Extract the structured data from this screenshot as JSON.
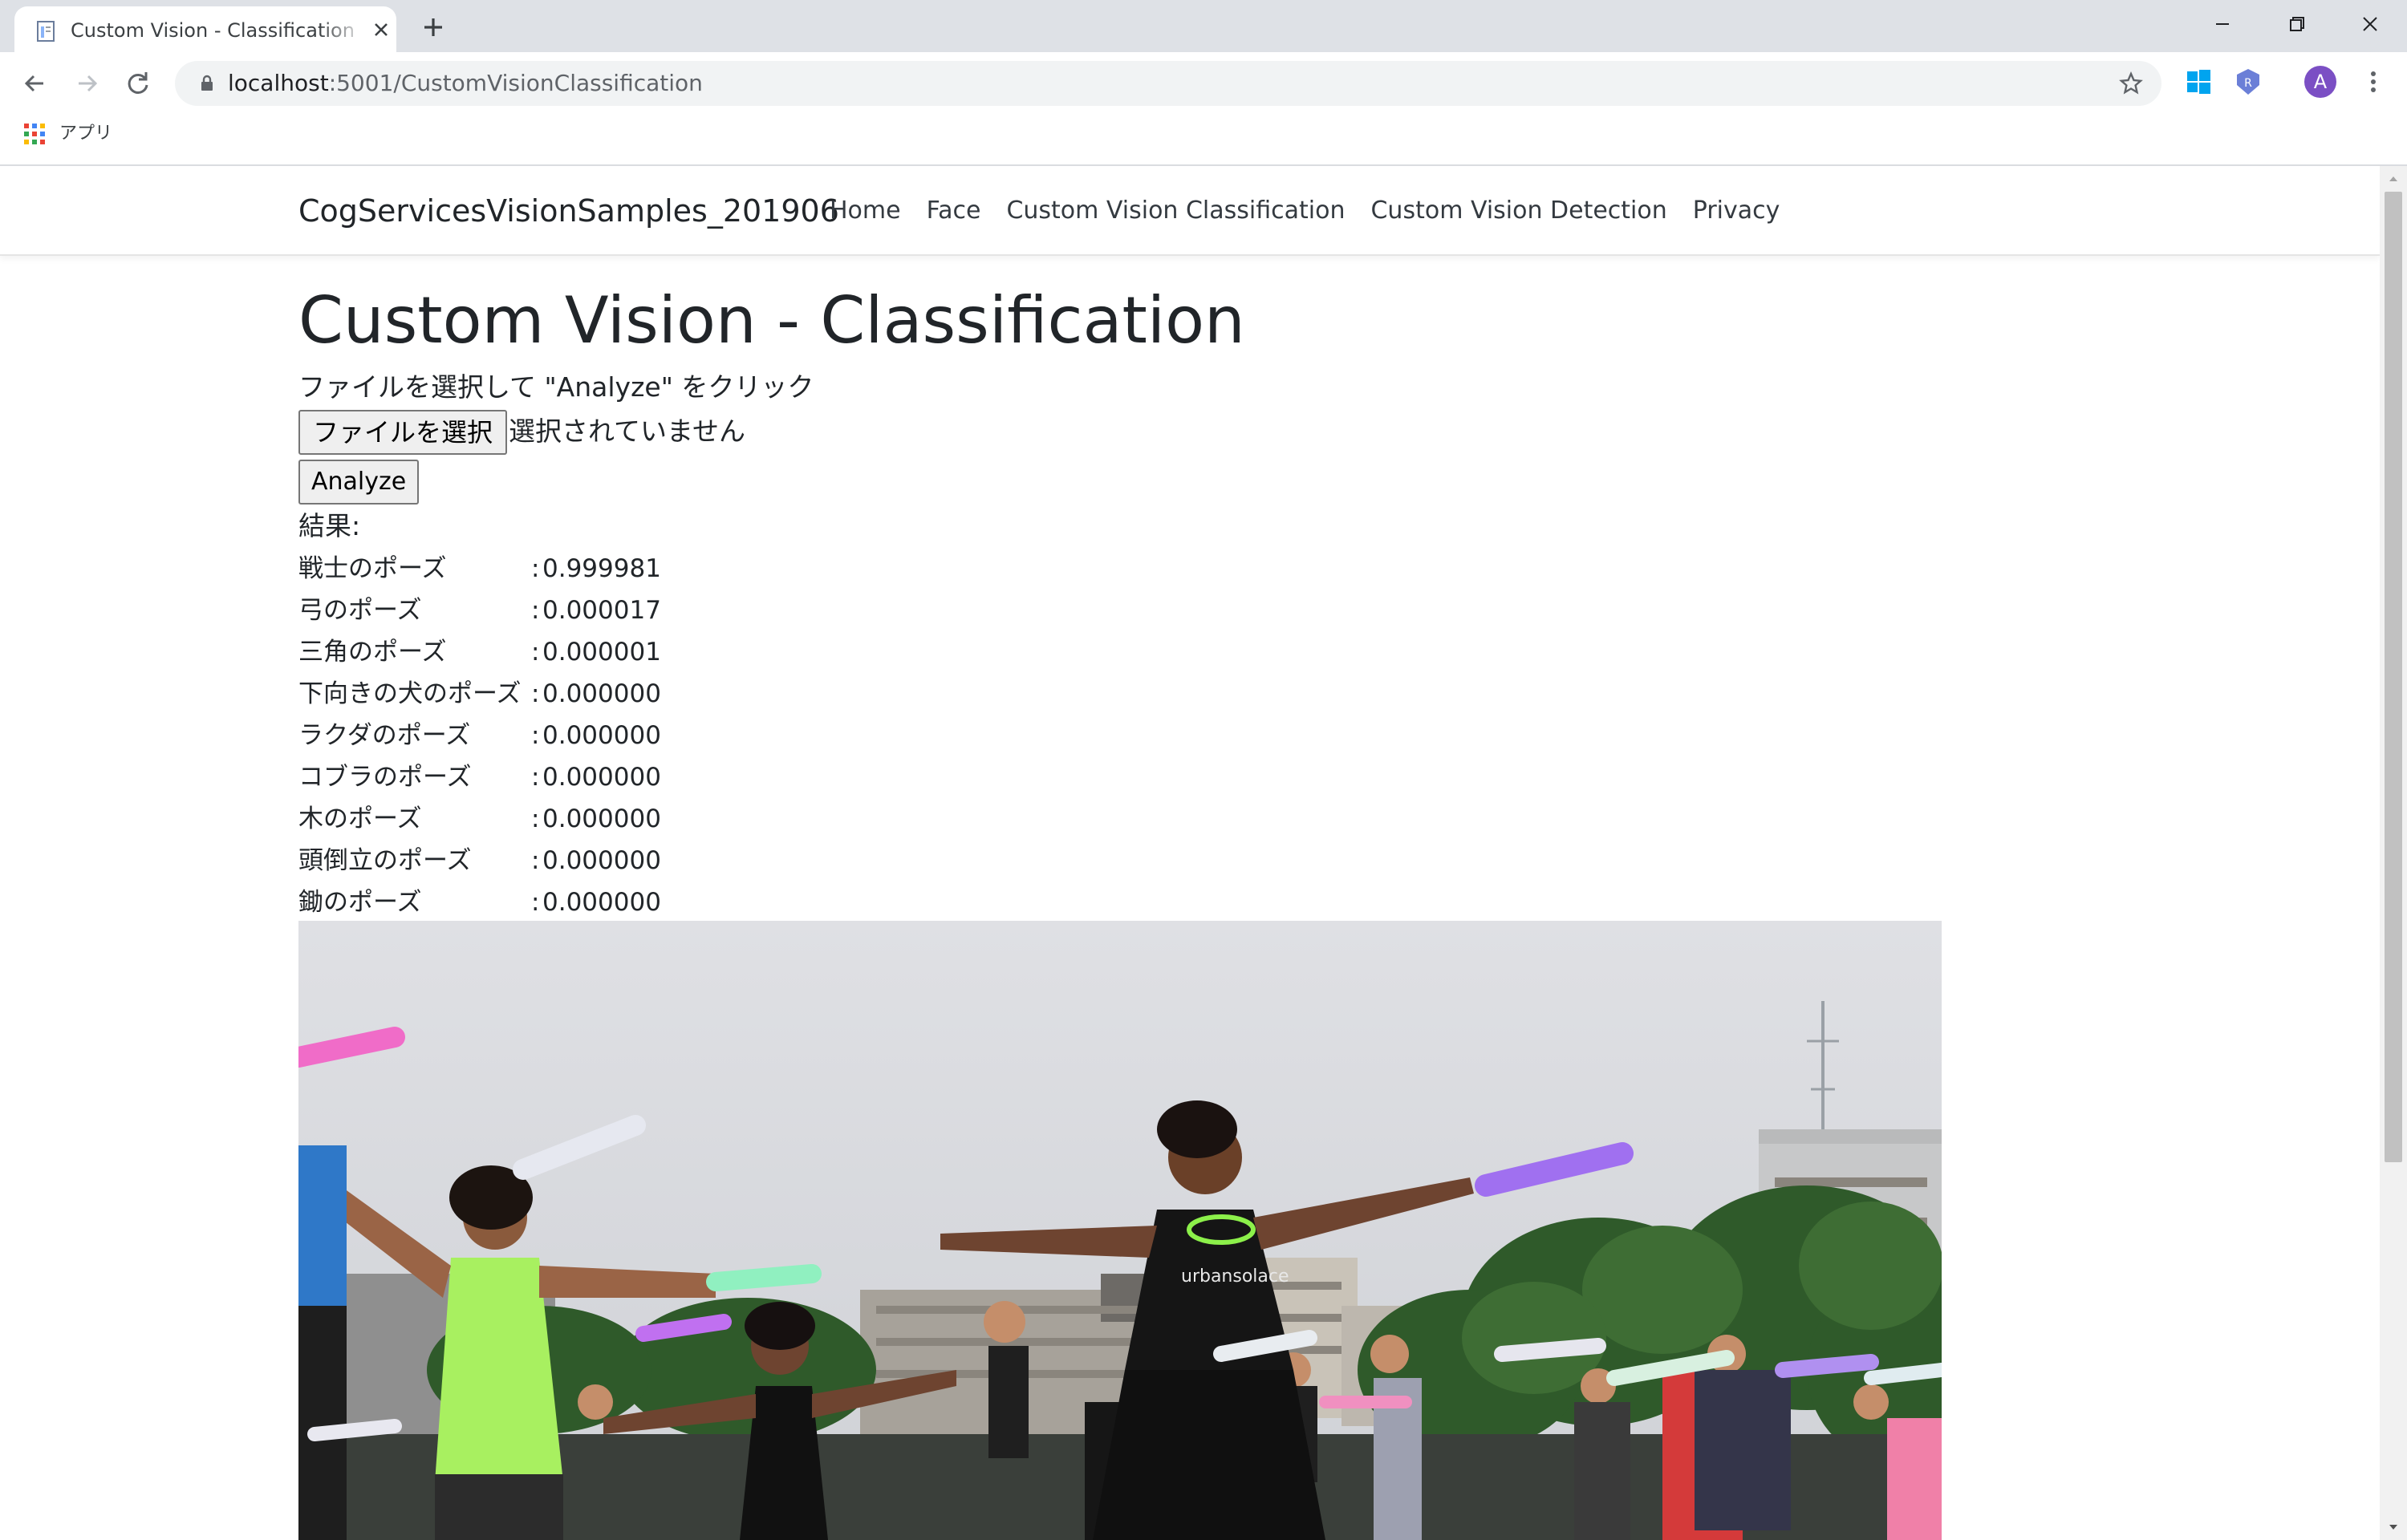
{
  "browser": {
    "tab_title": "Custom Vision - Classification - C",
    "url_host": "localhost",
    "url_rest": ":5001/CustomVisionClassification",
    "bookmark_apps_label": "アプリ",
    "profile_initial": "A"
  },
  "site": {
    "brand": "CogServicesVisionSamples_201906",
    "nav": [
      "Home",
      "Face",
      "Custom Vision Classification",
      "Custom Vision Detection",
      "Privacy"
    ]
  },
  "page": {
    "title": "Custom Vision - Classification",
    "instruction": "ファイルを選択して \"Analyze\" をクリック",
    "file_button": "ファイルを選択",
    "file_status": "選択されていません",
    "analyze_button": "Analyze",
    "result_label": "結果:",
    "results": [
      {
        "name": "戦士のポーズ",
        "score": "0.999981"
      },
      {
        "name": "弓のポーズ",
        "score": "0.000017"
      },
      {
        "name": "三角のポーズ",
        "score": "0.000001"
      },
      {
        "name": "下向きの犬のポーズ",
        "score": "0.000000"
      },
      {
        "name": "ラクダのポーズ",
        "score": "0.000000"
      },
      {
        "name": "コブラのポーズ",
        "score": "0.000000"
      },
      {
        "name": "木のポーズ",
        "score": "0.000000"
      },
      {
        "name": "頭倒立のポーズ",
        "score": "0.000000"
      },
      {
        "name": "鋤のポーズ",
        "score": "0.000000"
      }
    ],
    "result_separator": ":",
    "photo_shirt_text": "urbansolace"
  },
  "colors": {
    "tabbar": "#dee1e6",
    "omnibox": "#f1f3f4",
    "text": "#212529",
    "green_top": "#a8f060",
    "glow_pink": "#f06cc8",
    "glow_purple": "#a070f0"
  }
}
